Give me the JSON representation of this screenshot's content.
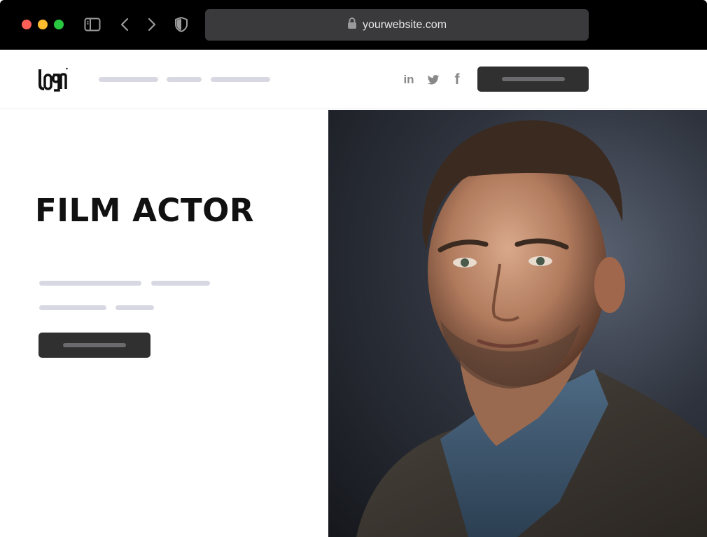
{
  "browser": {
    "url": "yourwebsite.com"
  },
  "site": {
    "logo_text": "logo",
    "social": {
      "linkedin": "in",
      "twitter": "twitter-icon",
      "facebook": "f"
    }
  },
  "hero": {
    "title": "FILM ACTOR"
  },
  "icons": [
    "sidebar-icon",
    "back-icon",
    "forward-icon",
    "shield-icon",
    "lock-icon",
    "linkedin-icon",
    "twitter-icon",
    "facebook-icon"
  ],
  "colors": {
    "chrome_bg": "#000000",
    "urlbar_bg": "#3a3a3c",
    "button_bg": "#303031",
    "placeholder": "#d8d8e2",
    "title": "#111111"
  }
}
